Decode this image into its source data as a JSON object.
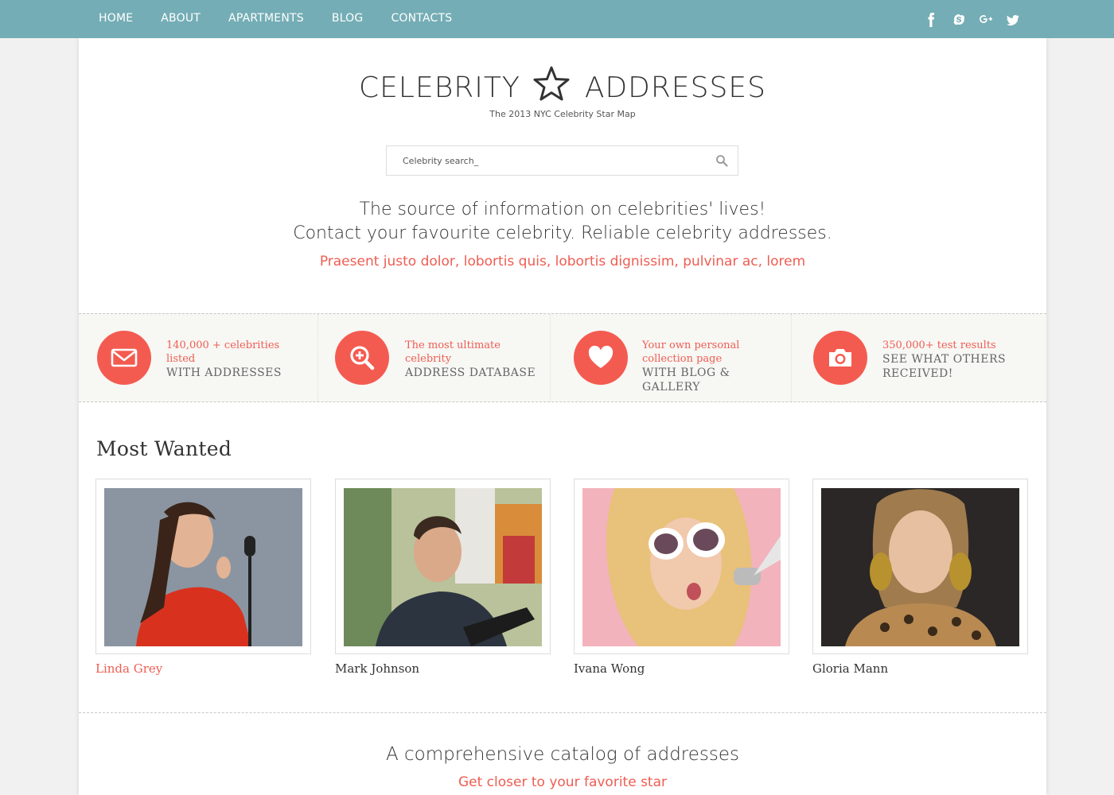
{
  "nav": {
    "items": [
      "HOME",
      "ABOUT",
      "APARTMENTS",
      "BLOG",
      "CONTACTS"
    ]
  },
  "social": [
    "facebook-icon",
    "skype-icon",
    "google-plus-icon",
    "twitter-icon"
  ],
  "header": {
    "logo_left": "CELEBRITY",
    "logo_right": "ADDRESSES",
    "tagline": "The 2013 NYC Celebrity Star Map"
  },
  "search": {
    "placeholder": "Celebrity search_"
  },
  "intro": {
    "line1": "The source of information on celebrities' lives!",
    "line2": "Contact your favourite celebrity. Reliable celebrity addresses.",
    "line3": "Praesent justo dolor, lobortis quis, lobortis dignissim, pulvinar ac, lorem"
  },
  "features": [
    {
      "icon": "envelope-icon",
      "highlight": "140,000 + celebrities listed",
      "sub": "WITH ADDRESSES"
    },
    {
      "icon": "search-plus-icon",
      "highlight": "The most ultimate celebrity",
      "sub": "ADDRESS DATABASE"
    },
    {
      "icon": "heart-icon",
      "highlight": "Your own personal collection page",
      "sub": "WITH BLOG & GALLERY"
    },
    {
      "icon": "camera-icon",
      "highlight": "350,000+ test results",
      "sub": "SEE WHAT OTHERS RECEIVED!"
    }
  ],
  "most_wanted": {
    "title": "Most Wanted",
    "people": [
      {
        "name": "Linda Grey"
      },
      {
        "name": "Mark Johnson"
      },
      {
        "name": "Ivana Wong"
      },
      {
        "name": "Gloria Mann"
      }
    ]
  },
  "catalog": {
    "title": "A comprehensive catalog of addresses",
    "subtitle": "Get closer to your favorite star"
  },
  "colors": {
    "topbar": "#74adb5",
    "accent": "#f45b50",
    "accent_text": "#ee5d52",
    "feature_bg": "#f7f7f4"
  }
}
